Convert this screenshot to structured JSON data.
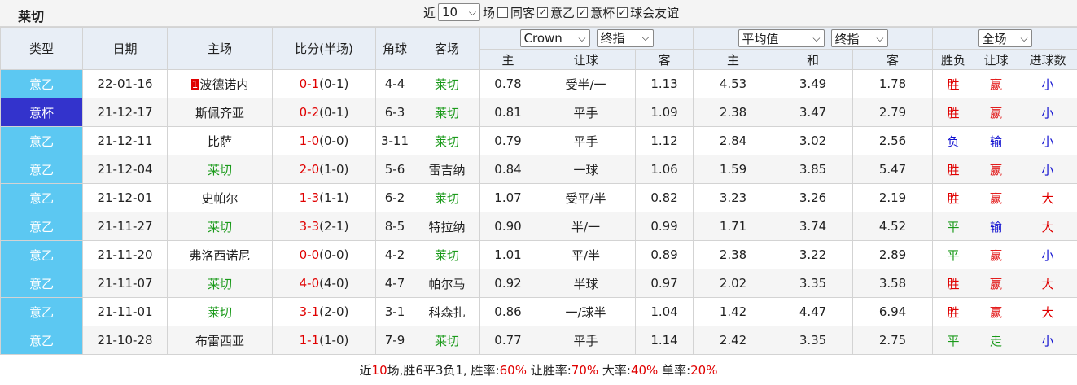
{
  "team_name": "莱切",
  "filters": {
    "recent_label": "近",
    "recent_value": "10",
    "games_label": "场",
    "same_venue_label": "同客",
    "leagues": [
      {
        "label": "意乙",
        "checked": true
      },
      {
        "label": "意杯",
        "checked": true
      },
      {
        "label": "球会友谊",
        "checked": true
      }
    ]
  },
  "header": {
    "type": "类型",
    "date": "日期",
    "home": "主场",
    "score": "比分(半场)",
    "corners": "角球",
    "away": "客场",
    "odds_company": "Crown",
    "odds_kind": "终指",
    "avg_select": "平均值",
    "avg_kind": "终指",
    "scope_select": "全场",
    "sub_home": "主",
    "sub_handicap": "让球",
    "sub_away": "客",
    "sub_home2": "主",
    "sub_draw": "和",
    "sub_away2": "客",
    "sub_result": "胜负",
    "sub_hcp_result": "让球",
    "sub_goals": "进球数"
  },
  "rows": [
    {
      "type": "意乙",
      "date": "22-01-16",
      "home_rank": "1",
      "home": "波德诺内",
      "score": "0-1",
      "half": "(0-1)",
      "corners": "4-4",
      "away": "莱切",
      "o_home": "0.78",
      "handicap": "受半/一",
      "o_away": "1.13",
      "a_home": "4.53",
      "a_draw": "3.49",
      "a_away": "1.78",
      "result": "胜",
      "hcp": "赢",
      "goals": "小"
    },
    {
      "type": "意杯",
      "date": "21-12-17",
      "home": "斯佩齐亚",
      "score": "0-2",
      "half": "(0-1)",
      "corners": "6-3",
      "away": "莱切",
      "o_home": "0.81",
      "handicap": "平手",
      "o_away": "1.09",
      "a_home": "2.38",
      "a_draw": "3.47",
      "a_away": "2.79",
      "result": "胜",
      "hcp": "赢",
      "goals": "小"
    },
    {
      "type": "意乙",
      "date": "21-12-11",
      "home": "比萨",
      "score": "1-0",
      "half": "(0-0)",
      "corners": "3-11",
      "away": "莱切",
      "o_home": "0.79",
      "handicap": "平手",
      "o_away": "1.12",
      "a_home": "2.84",
      "a_draw": "3.02",
      "a_away": "2.56",
      "result": "负",
      "hcp": "输",
      "goals": "小"
    },
    {
      "type": "意乙",
      "date": "21-12-04",
      "home": "莱切",
      "score": "2-0",
      "half": "(1-0)",
      "corners": "5-6",
      "away": "雷吉纳",
      "o_home": "0.84",
      "handicap": "一球",
      "o_away": "1.06",
      "a_home": "1.59",
      "a_draw": "3.85",
      "a_away": "5.47",
      "result": "胜",
      "hcp": "赢",
      "goals": "小"
    },
    {
      "type": "意乙",
      "date": "21-12-01",
      "home": "史帕尔",
      "score": "1-3",
      "half": "(1-1)",
      "corners": "6-2",
      "away": "莱切",
      "o_home": "1.07",
      "handicap": "受平/半",
      "o_away": "0.82",
      "a_home": "3.23",
      "a_draw": "3.26",
      "a_away": "2.19",
      "result": "胜",
      "hcp": "赢",
      "goals": "大"
    },
    {
      "type": "意乙",
      "date": "21-11-27",
      "home": "莱切",
      "score": "3-3",
      "half": "(2-1)",
      "corners": "8-5",
      "away": "特拉纳",
      "o_home": "0.90",
      "handicap": "半/一",
      "o_away": "0.99",
      "a_home": "1.71",
      "a_draw": "3.74",
      "a_away": "4.52",
      "result": "平",
      "hcp": "输",
      "goals": "大"
    },
    {
      "type": "意乙",
      "date": "21-11-20",
      "home": "弗洛西诺尼",
      "score": "0-0",
      "half": "(0-0)",
      "corners": "4-2",
      "away": "莱切",
      "o_home": "1.01",
      "handicap": "平/半",
      "o_away": "0.89",
      "a_home": "2.38",
      "a_draw": "3.22",
      "a_away": "2.89",
      "result": "平",
      "hcp": "赢",
      "goals": "小"
    },
    {
      "type": "意乙",
      "date": "21-11-07",
      "home": "莱切",
      "score": "4-0",
      "half": "(4-0)",
      "corners": "4-7",
      "away": "帕尔马",
      "o_home": "0.92",
      "handicap": "半球",
      "o_away": "0.97",
      "a_home": "2.02",
      "a_draw": "3.35",
      "a_away": "3.58",
      "result": "胜",
      "hcp": "赢",
      "goals": "大"
    },
    {
      "type": "意乙",
      "date": "21-11-01",
      "home": "莱切",
      "score": "3-1",
      "half": "(2-0)",
      "corners": "3-1",
      "away": "科森扎",
      "o_home": "0.86",
      "handicap": "一/球半",
      "o_away": "1.04",
      "a_home": "1.42",
      "a_draw": "4.47",
      "a_away": "6.94",
      "result": "胜",
      "hcp": "赢",
      "goals": "大"
    },
    {
      "type": "意乙",
      "date": "21-10-28",
      "home": "布雷西亚",
      "score": "1-1",
      "half": "(1-0)",
      "corners": "7-9",
      "away": "莱切",
      "o_home": "0.77",
      "handicap": "平手",
      "o_away": "1.14",
      "a_home": "2.42",
      "a_draw": "3.35",
      "a_away": "2.75",
      "result": "平",
      "hcp": "走",
      "goals": "小"
    }
  ],
  "summary": {
    "t1": "近",
    "games": "10",
    "t2": "场,胜6平3负1, 胜率:",
    "win_rate": "60%",
    "t3": " 让胜率:",
    "hcp_rate": "70%",
    "t4": " 大率:",
    "over_rate": "40%",
    "t5": " 单率:",
    "odd_rate": "20%"
  },
  "colors": {
    "league_cell": "#5cc8f2",
    "cup_cell": "#3333cc",
    "team_highlight": "#1a9a1a",
    "win": "#e00000",
    "lose": "#1010d0",
    "draw": "#1a9a1a"
  }
}
